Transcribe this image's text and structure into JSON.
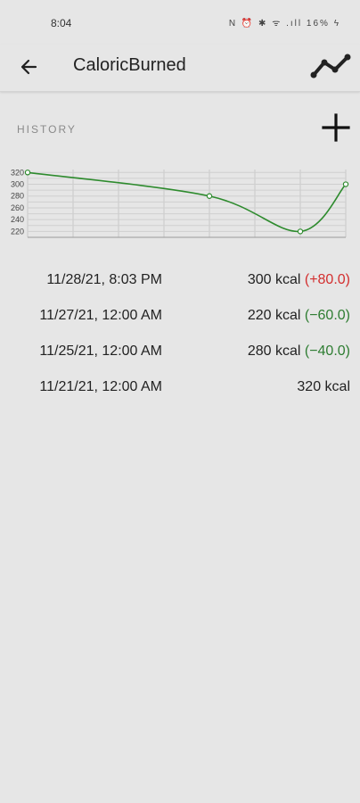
{
  "status_bar": {
    "time": "8:04",
    "icons": "N ⏰ ✱ ᯤ .ıll 16% ϟ"
  },
  "app_bar": {
    "title": "CaloricBurned",
    "back_icon": "arrow-left",
    "trend_icon": "trend-line"
  },
  "history": {
    "label": "HISTORY",
    "add_icon": "plus"
  },
  "chart_data": {
    "type": "line",
    "x": [
      "11/21/21",
      "11/25/21",
      "11/27/21",
      "11/28/21"
    ],
    "values": [
      320,
      280,
      220,
      300
    ],
    "yticks": [
      220,
      240,
      260,
      280,
      300,
      320
    ],
    "ylim": [
      210,
      325
    ],
    "grid": true,
    "line_color": "#2e8b2e"
  },
  "entries": [
    {
      "date": "11/28/21, 8:03 PM",
      "value": "300 kcal",
      "delta": "(+80.0)",
      "trend": "up"
    },
    {
      "date": "11/27/21, 12:00 AM",
      "value": "220 kcal",
      "delta": "(−60.0)",
      "trend": "down"
    },
    {
      "date": "11/25/21, 12:00 AM",
      "value": "280 kcal",
      "delta": "(−40.0)",
      "trend": "down"
    },
    {
      "date": "11/21/21, 12:00 AM",
      "value": "320 kcal",
      "delta": "",
      "trend": ""
    }
  ],
  "colors": {
    "background": "#e6e6e6",
    "increase": "#d32f2f",
    "decrease": "#2e7d32"
  }
}
